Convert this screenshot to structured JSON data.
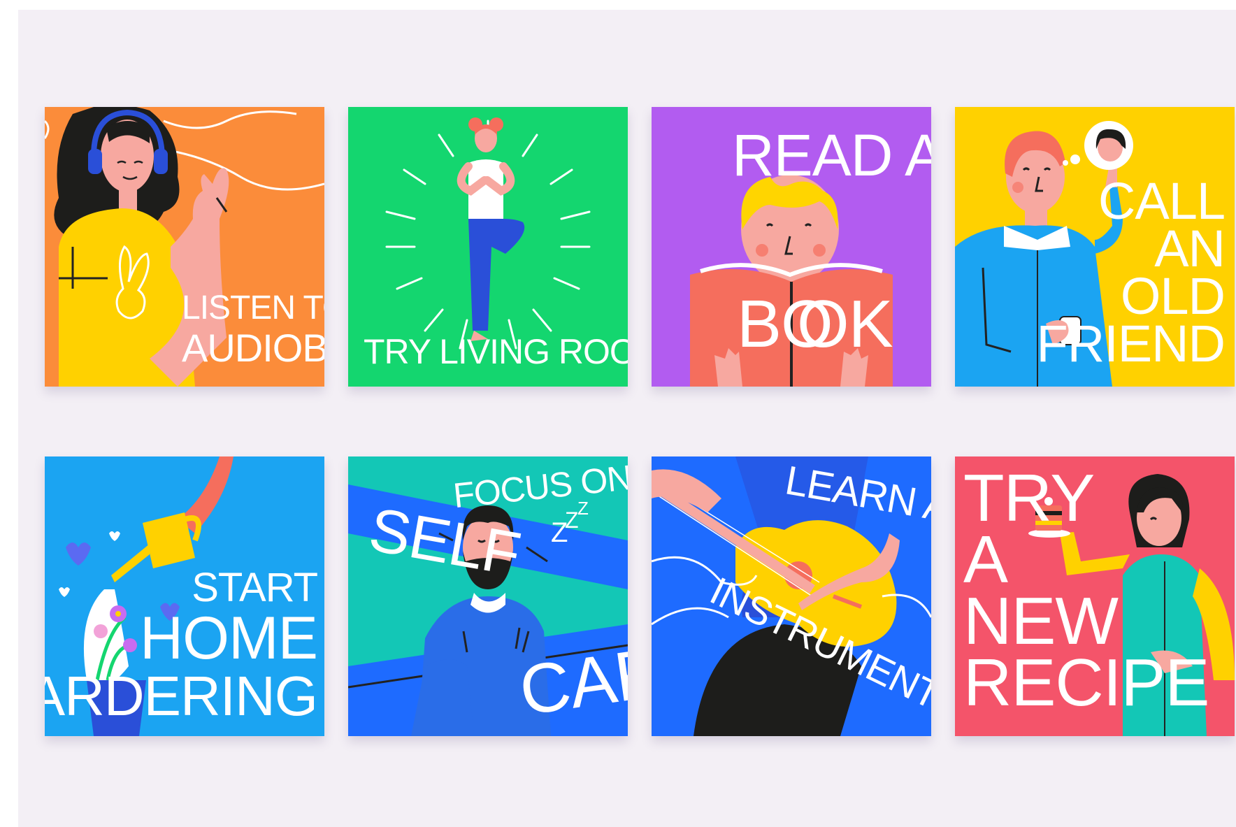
{
  "cards": [
    {
      "id": "audiobook",
      "bg": "#fb8c3a",
      "lines": [
        "LISTEN TO AN",
        "AUDIOBOOK"
      ]
    },
    {
      "id": "yoga",
      "bg": "#14d66f",
      "lines": [
        "TRY LIVING ROOM YOGA"
      ]
    },
    {
      "id": "book",
      "bg": "#b25cf0",
      "lines": [
        "READ A",
        "BO",
        "OK"
      ]
    },
    {
      "id": "friend",
      "bg": "#ffd100",
      "lines": [
        "CALL",
        "AN",
        "OLD",
        "FRIEND"
      ]
    },
    {
      "id": "gardening",
      "bg": "#1ba4f2",
      "lines": [
        "START",
        "HOME",
        "GARDERING"
      ]
    },
    {
      "id": "selfcare",
      "bg": "#13c7b6",
      "lines": [
        "FOCUS ON",
        "SELF",
        "CARE",
        "Z",
        "Z",
        "Z"
      ]
    },
    {
      "id": "instrument",
      "bg": "#1e6bff",
      "lines": [
        "LEARN AN",
        "INSTRUMENT"
      ]
    },
    {
      "id": "recipe",
      "bg": "#f4546a",
      "lines": [
        "TRY",
        "A",
        "NEW",
        "RECIPE"
      ]
    }
  ],
  "colors": {
    "board_bg": "#f3eff5",
    "text": "#ffffff",
    "skin": "#f7a8a0",
    "hair_dark": "#1d1d1b",
    "hair_blond": "#ffd500",
    "hair_pink": "#f56e5d"
  },
  "icons": [
    "headphones-icon",
    "bunny-shirt-icon",
    "sunburst-icon",
    "open-book-icon",
    "thought-bubble-icon",
    "phone-icon",
    "watering-can-icon",
    "flower-pot-icon",
    "heart-icon",
    "sleep-z-icon",
    "guitar-icon",
    "cake-icon"
  ]
}
